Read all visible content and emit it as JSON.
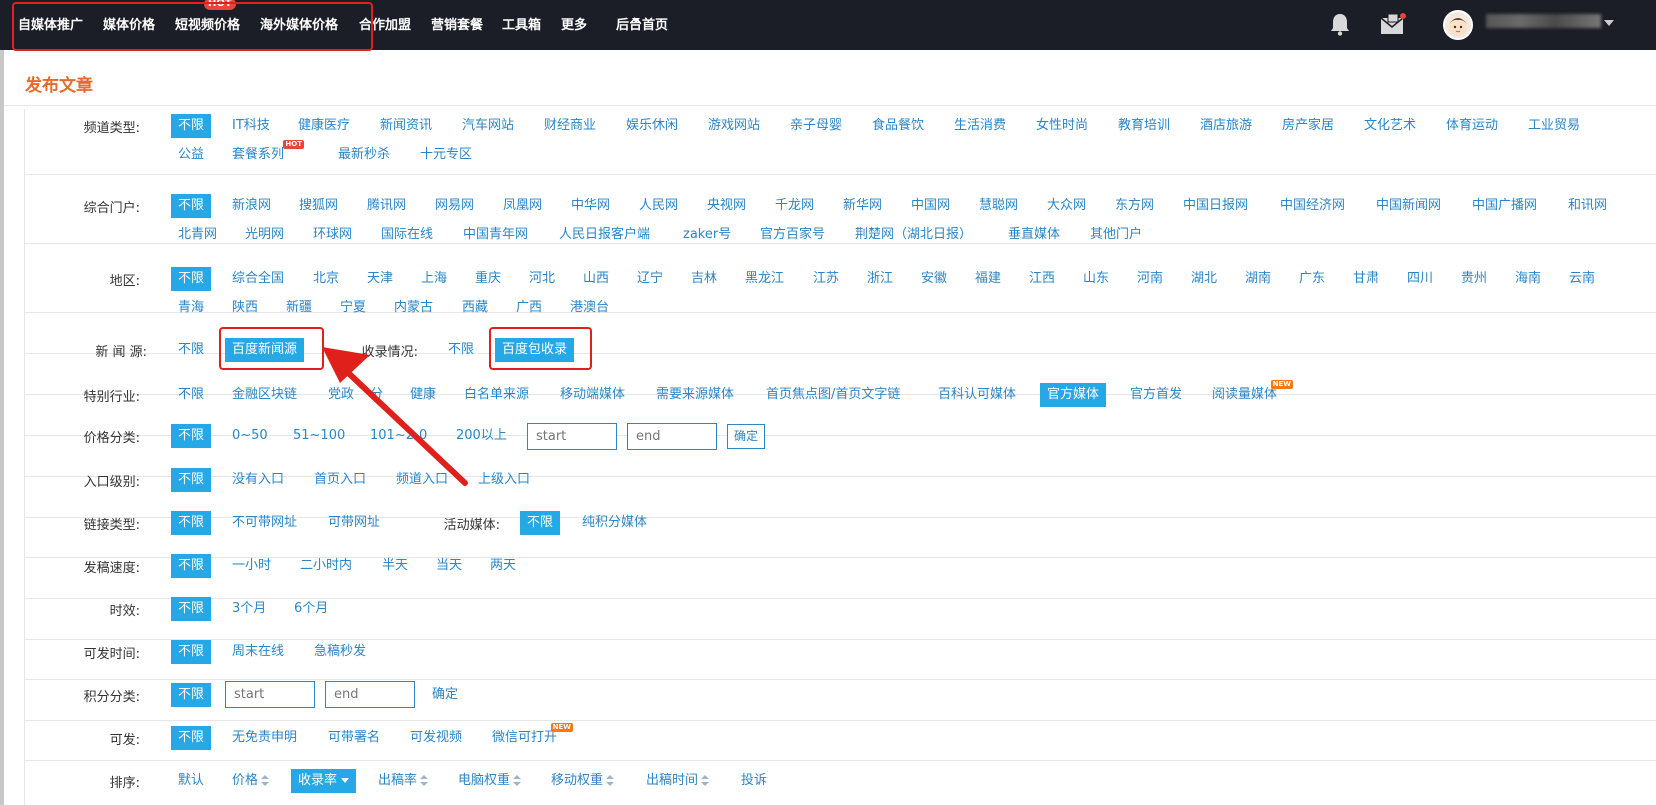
{
  "nav": {
    "items": [
      "自媒体推广",
      "媒体价格",
      "短视频价格",
      "海外媒体价格",
      "合作加盟",
      "营销套餐",
      "工具箱",
      "更多",
      "后台首页"
    ],
    "hot_badge": "HOT"
  },
  "page_title": "发布文章",
  "filters": {
    "channel": {
      "label": "频道类型:",
      "options": [
        "不限",
        "IT科技",
        "健康医疗",
        "新闻资讯",
        "汽车网站",
        "财经商业",
        "娱乐休闲",
        "游戏网站",
        "亲子母婴",
        "食品餐饮",
        "生活消费",
        "女性时尚",
        "教育培训",
        "酒店旅游",
        "房产家居",
        "文化艺术",
        "体育运动",
        "工业贸易",
        "公益",
        "套餐系列",
        "最新秒杀",
        "十元专区"
      ]
    },
    "portal": {
      "label": "综合门户:",
      "options": [
        "不限",
        "新浪网",
        "搜狐网",
        "腾讯网",
        "网易网",
        "凤凰网",
        "中华网",
        "人民网",
        "央视网",
        "千龙网",
        "新华网",
        "中国网",
        "慧聪网",
        "大众网",
        "东方网",
        "中国日报网",
        "中国经济网",
        "中国新闻网",
        "中国广播网",
        "和讯网",
        "北青网",
        "光明网",
        "环球网",
        "国际在线",
        "中国青年网",
        "人民日报客户端",
        "zaker号",
        "官方百家号",
        "荆楚网（湖北日报）",
        "垂直媒体",
        "其他门户"
      ]
    },
    "region": {
      "label": "地区:",
      "options": [
        "不限",
        "综合全国",
        "北京",
        "天津",
        "上海",
        "重庆",
        "河北",
        "山西",
        "辽宁",
        "吉林",
        "黑龙江",
        "江苏",
        "浙江",
        "安徽",
        "福建",
        "江西",
        "山东",
        "河南",
        "湖北",
        "湖南",
        "广东",
        "甘肃",
        "四川",
        "贵州",
        "海南",
        "云南",
        "青海",
        "陕西",
        "新疆",
        "宁夏",
        "内蒙古",
        "西藏",
        "广西",
        "港澳台"
      ]
    },
    "news_source": {
      "label": "新 闻 源:",
      "options": [
        "不限",
        "百度新闻源"
      ],
      "index_label": "收录情况:",
      "index_options": [
        "不限",
        "百度包收录"
      ]
    },
    "industry": {
      "label": "特别行业:",
      "options": [
        "不限",
        "金融区块链",
        "党政",
        "分",
        "健康",
        "白名单来源",
        "移动端媒体",
        "需要来源媒体",
        "首页焦点图/首页文字链",
        "百科认可媒体",
        "官方媒体",
        "官方首发",
        "阅读量媒体"
      ]
    },
    "price": {
      "label": "价格分类:",
      "options": [
        "不限",
        "0~50",
        "51~100",
        "101~2",
        "0",
        "200以上"
      ],
      "start_placeholder": "start",
      "end_placeholder": "end",
      "confirm": "确定"
    },
    "entry": {
      "label": "入口级别:",
      "options": [
        "不限",
        "没有入口",
        "首页入口",
        "频道入口",
        "上级入口"
      ]
    },
    "link": {
      "label": "链接类型:",
      "options": [
        "不限",
        "不可带网址",
        "可带网址"
      ],
      "active_label": "活动媒体:",
      "active_options": [
        "不限",
        "纯积分媒体"
      ]
    },
    "speed": {
      "label": "发稿速度:",
      "options": [
        "不限",
        "一小时",
        "二小时内",
        "半天",
        "当天",
        "两天"
      ]
    },
    "validity": {
      "label": "时效:",
      "options": [
        "不限",
        "3个月",
        "6个月"
      ]
    },
    "publish_time": {
      "label": "可发时间:",
      "options": [
        "不限",
        "周末在线",
        "急稿秒发"
      ]
    },
    "points": {
      "label": "积分分类:",
      "options": [
        "不限"
      ],
      "start_placeholder": "start",
      "end_placeholder": "end",
      "confirm": "确定"
    },
    "publishable": {
      "label": "可发:",
      "options": [
        "不限",
        "无免责申明",
        "可带署名",
        "可发视频",
        "微信可打开"
      ]
    },
    "sort": {
      "label": "排序:",
      "options": [
        "默认",
        "价格",
        "收录率",
        "出稿率",
        "电脑权重",
        "移动权重",
        "出稿时间",
        "投诉"
      ]
    }
  },
  "badges": {
    "new": "NEW",
    "hot": "HOT"
  },
  "colors": {
    "accent": "#26a8e6",
    "link": "#2a86c7",
    "title": "#e9692c",
    "nav_bg": "#1b1d27",
    "highlight": "#e0201b"
  }
}
